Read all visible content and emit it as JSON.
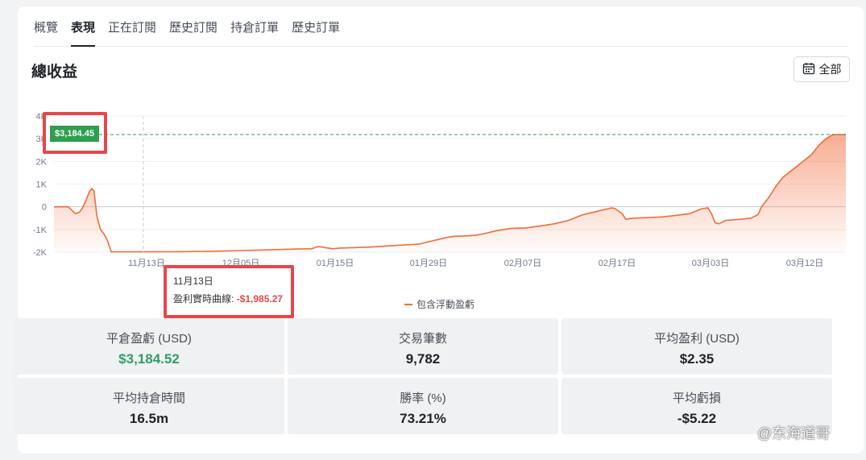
{
  "tabs": [
    {
      "label": "概覽",
      "active": false
    },
    {
      "label": "表現",
      "active": true
    },
    {
      "label": "正在訂閱",
      "active": false
    },
    {
      "label": "歷史訂閱",
      "active": false
    },
    {
      "label": "持倉訂單",
      "active": false
    },
    {
      "label": "歷史訂單",
      "active": false
    }
  ],
  "header": {
    "title": "總收益",
    "range_label": "全部",
    "range_icon": "calendar-icon"
  },
  "chart_data": {
    "type": "area",
    "series": [
      {
        "name": "包含浮動盈虧",
        "color": "#f26b3a"
      }
    ],
    "y_ticks": [
      "4K",
      "3K",
      "2K",
      "1K",
      "0",
      "-1K",
      "-2K"
    ],
    "y_range": [
      -2000,
      4000
    ],
    "x_ticks": [
      "11月13日",
      "12月05日",
      "01月15日",
      "01月29日",
      "02月07日",
      "02月17日",
      "03月03日",
      "03月12日"
    ],
    "points": [
      [
        0,
        0
      ],
      [
        2,
        0
      ],
      [
        2.5,
        -150
      ],
      [
        3,
        -300
      ],
      [
        3.5,
        -250
      ],
      [
        4,
        -50
      ],
      [
        4.5,
        300
      ],
      [
        5,
        700
      ],
      [
        5.3,
        800
      ],
      [
        5.6,
        700
      ],
      [
        6,
        -400
      ],
      [
        6.5,
        -1000
      ],
      [
        7,
        -1200
      ],
      [
        7.5,
        -1500
      ],
      [
        8,
        -1985
      ],
      [
        12,
        -1985
      ],
      [
        18,
        -1980
      ],
      [
        22,
        -1960
      ],
      [
        26,
        -1930
      ],
      [
        30,
        -1900
      ],
      [
        34,
        -1860
      ],
      [
        36,
        -1850
      ],
      [
        37,
        -1750
      ],
      [
        38,
        -1800
      ],
      [
        39,
        -1850
      ],
      [
        40,
        -1820
      ],
      [
        44,
        -1780
      ],
      [
        48,
        -1700
      ],
      [
        51,
        -1650
      ],
      [
        53,
        -1500
      ],
      [
        55,
        -1350
      ],
      [
        56,
        -1300
      ],
      [
        58,
        -1280
      ],
      [
        59,
        -1250
      ],
      [
        60,
        -1200
      ],
      [
        62,
        -1050
      ],
      [
        64,
        -950
      ],
      [
        66,
        -930
      ],
      [
        68,
        -850
      ],
      [
        70,
        -750
      ],
      [
        72,
        -600
      ],
      [
        74,
        -350
      ],
      [
        76,
        -200
      ],
      [
        78,
        -50
      ],
      [
        78.5,
        -80
      ],
      [
        79.5,
        -300
      ],
      [
        80,
        -550
      ],
      [
        81,
        -500
      ],
      [
        83,
        -480
      ],
      [
        85,
        -450
      ],
      [
        87,
        -380
      ],
      [
        89,
        -300
      ],
      [
        90.5,
        -100
      ],
      [
        91.5,
        -50
      ],
      [
        92,
        -300
      ],
      [
        92.5,
        -700
      ],
      [
        93,
        -750
      ],
      [
        94,
        -600
      ],
      [
        96,
        -550
      ],
      [
        97.5,
        -500
      ],
      [
        98.5,
        -350
      ],
      [
        99,
        0
      ],
      [
        100,
        400
      ],
      [
        101,
        900
      ],
      [
        102,
        1300
      ],
      [
        104,
        1800
      ],
      [
        106,
        2300
      ],
      [
        107,
        2700
      ],
      [
        108,
        3000
      ],
      [
        109,
        3184.45
      ],
      [
        110.8,
        3184.45
      ]
    ],
    "x_max": 110.8,
    "reference_value": 3184.45,
    "reference_label": "$3,184.45",
    "reference_color": "#2e9e4f",
    "highlight_x": 12.5
  },
  "tooltip": {
    "date": "11月13日",
    "label": "盈利實時曲線: ",
    "value": "-$1,985.27",
    "value_color": "#e5474b"
  },
  "legend": {
    "label": "包含浮動盈虧"
  },
  "stats": [
    {
      "label": "平倉盈虧 (USD)",
      "value": "$3,184.52",
      "positive": true
    },
    {
      "label": "交易筆數",
      "value": "9,782",
      "positive": false
    },
    {
      "label": "平均盈利 (USD)",
      "value": "$2.35",
      "positive": false
    },
    {
      "label": "平均持倉時間",
      "value": "16.5m",
      "positive": false
    },
    {
      "label": "勝率 (%)",
      "value": "73.21%",
      "positive": false
    },
    {
      "label": "平均虧損",
      "value": "-$5.22",
      "positive": false
    }
  ],
  "watermark": "@东海道哥"
}
